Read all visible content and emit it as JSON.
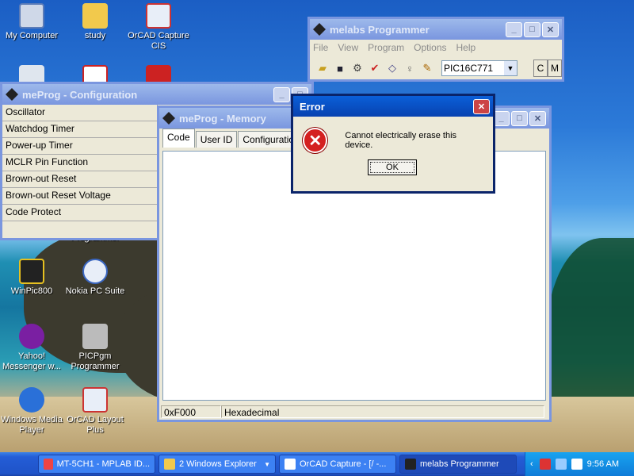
{
  "desktop": {
    "icons": [
      {
        "label": "My Computer"
      },
      {
        "label": "study"
      },
      {
        "label": "OrCAD Capture CIS"
      },
      {
        "label": "WinPic800"
      },
      {
        "label": "Nokia PC Suite"
      },
      {
        "label": "Yahoo! Messenger w..."
      },
      {
        "label": "PICPgm Programmer"
      },
      {
        "label": "Windows Media Player"
      },
      {
        "label": "OrCAD Layout Plus"
      }
    ],
    "partial_icon_label": "Programmer"
  },
  "config_window": {
    "title": "meProg - Configuration",
    "items": [
      "Oscillator",
      "Watchdog Timer",
      "Power-up Timer",
      "MCLR Pin Function",
      "Brown-out Reset",
      "Brown-out Reset Voltage",
      "Code Protect"
    ]
  },
  "memory_window": {
    "title": "meProg - Memory",
    "tabs": [
      "Code",
      "User ID",
      "Configuration"
    ],
    "status_address": "0xF000",
    "status_mode": "Hexadecimal"
  },
  "programmer_window": {
    "title": "melabs Programmer",
    "menu": [
      "File",
      "View",
      "Program",
      "Options",
      "Help"
    ],
    "device": "PIC16C771",
    "btn_c": "C",
    "btn_m": "M"
  },
  "error_dialog": {
    "title": "Error",
    "message": "Cannot electrically erase this device.",
    "ok_label": "OK"
  },
  "taskbar": {
    "tasks": [
      "MT-5CH1 - MPLAB ID...",
      "2 Windows Explorer",
      "OrCAD Capture - [/ -...",
      "melabs Programmer"
    ],
    "clock": "9:56 AM"
  }
}
